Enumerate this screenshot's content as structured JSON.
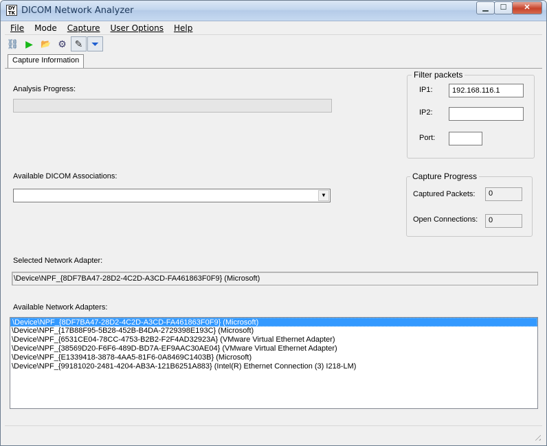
{
  "window": {
    "title": "DICOM Network Analyzer",
    "icon_text": "DY\nTK",
    "caption": {
      "minimize": "▁",
      "maximize": "☐",
      "close": "✕"
    }
  },
  "menu": [
    {
      "key": "file",
      "label": "File"
    },
    {
      "key": "mode",
      "label": "Mode"
    },
    {
      "key": "capture",
      "label": "Capture"
    },
    {
      "key": "user_options",
      "label": "User Options"
    },
    {
      "key": "help",
      "label": "Help"
    }
  ],
  "toolbar": {
    "network_icon": "network-icon",
    "start_icon": "play-icon",
    "open_icon": "open-folder-icon",
    "settings_icon": "gear-icon",
    "edit_icon": "pencil-icon",
    "filter_icon": "filter-icon",
    "glyphs": {
      "network": "⛓",
      "start": "▶",
      "open": "📂",
      "settings": "⚙",
      "edit": "✎",
      "filter": "⏷"
    },
    "colors": {
      "start": "#18b818",
      "filter": "#1f5fd1"
    }
  },
  "tabs": [
    {
      "label": "Capture Information"
    }
  ],
  "analysis": {
    "label": "Analysis Progress:",
    "progress": 0
  },
  "associations": {
    "label": "Available DICOM Associations:",
    "value": "",
    "dropdown_arrow": "▼"
  },
  "filter": {
    "title": "Filter packets",
    "ip1_label": "IP1:",
    "ip1_value": "192.168.116.1",
    "ip2_label": "IP2:",
    "ip2_value": "",
    "port_label": "Port:",
    "port_value": ""
  },
  "capture_progress": {
    "title": "Capture Progress",
    "packets_label": "Captured Packets:",
    "packets_value": "0",
    "connections_label": "Open Connections:",
    "connections_value": "0"
  },
  "selected_adapter": {
    "label": "Selected Network Adapter:",
    "value": "\\Device\\NPF_{8DF7BA47-28D2-4C2D-A3CD-FA461863F0F9} (Microsoft)"
  },
  "adapters": {
    "label": "Available Network Adapters:",
    "items": [
      "\\Device\\NPF_{8DF7BA47-28D2-4C2D-A3CD-FA461863F0F9} (Microsoft)",
      "\\Device\\NPF_{17B88F95-5B28-452B-B4DA-2729398E193C} (Microsoft)",
      "\\Device\\NPF_{6531CE04-78CC-4753-B2B2-F2F4AD32923A} (VMware Virtual Ethernet Adapter)",
      "\\Device\\NPF_{38569D20-F6F6-489D-BD7A-EF9AAC30AE04} (VMware Virtual Ethernet Adapter)",
      "\\Device\\NPF_{E1339418-3878-4AA5-81F6-0A8469C1403B} (Microsoft)",
      "\\Device\\NPF_{99181020-2481-4204-AB3A-121B6251A883} (Intel(R) Ethernet Connection (3) I218-LM)"
    ],
    "selected_index": 0
  }
}
